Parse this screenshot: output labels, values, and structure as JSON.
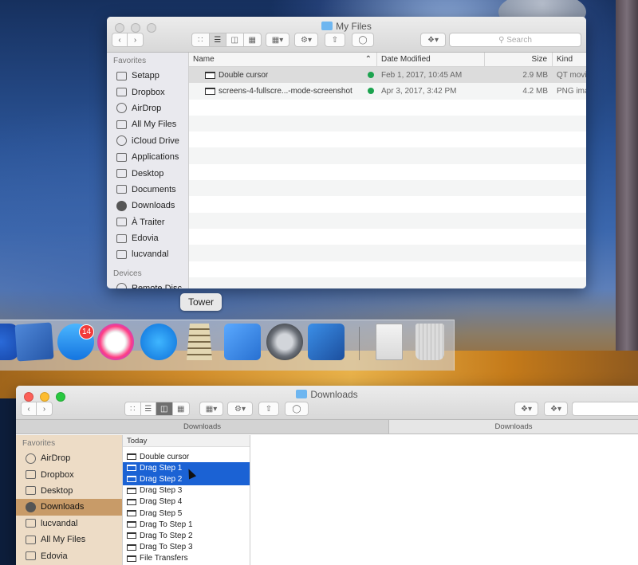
{
  "top_window": {
    "title": "My Files",
    "search_placeholder": "Search",
    "sidebar": {
      "favorites_heading": "Favorites",
      "items": [
        {
          "label": "Setapp",
          "icon": "folder-icon"
        },
        {
          "label": "Dropbox",
          "icon": "dropbox-folder-icon"
        },
        {
          "label": "AirDrop",
          "icon": "airdrop-icon"
        },
        {
          "label": "All My Files",
          "icon": "all-files-icon"
        },
        {
          "label": "iCloud Drive",
          "icon": "cloud-icon"
        },
        {
          "label": "Applications",
          "icon": "applications-icon"
        },
        {
          "label": "Desktop",
          "icon": "desktop-icon"
        },
        {
          "label": "Documents",
          "icon": "documents-icon"
        },
        {
          "label": "Downloads",
          "icon": "downloads-icon"
        },
        {
          "label": "À Traiter",
          "icon": "folder-icon"
        },
        {
          "label": "Edovia",
          "icon": "folder-icon"
        },
        {
          "label": "lucvandal",
          "icon": "home-icon"
        }
      ],
      "devices_heading": "Devices",
      "devices": [
        {
          "label": "Remote Disc",
          "icon": "disc-icon"
        }
      ]
    },
    "columns": {
      "name": "Name",
      "date": "Date Modified",
      "size": "Size",
      "kind": "Kind"
    },
    "files": [
      {
        "name": "Double cursor",
        "date": "Feb 1, 2017, 10:45 AM",
        "size": "2.9 MB",
        "kind": "QT movie"
      },
      {
        "name": "screens-4-fullscre...-mode-screenshot",
        "date": "Apr 3, 2017, 3:42 PM",
        "size": "4.2 MB",
        "kind": "PNG image"
      }
    ]
  },
  "dock": {
    "tooltip": "Tower",
    "messages_badge": "14",
    "apps": [
      "mail-icon",
      "messages-icon",
      "itunes-icon",
      "app-store-icon",
      "tower-icon",
      "xcode-icon",
      "system-preferences-icon",
      "vmware-fusion-icon",
      "disk-utility-icon",
      "trash-icon"
    ]
  },
  "bottom_window": {
    "title": "Downloads",
    "path_tabs": [
      "Downloads",
      "Downloads"
    ],
    "sidebar": {
      "favorites_heading": "Favorites",
      "items": [
        {
          "label": "AirDrop",
          "icon": "airdrop-icon"
        },
        {
          "label": "Dropbox",
          "icon": "dropbox-folder-icon"
        },
        {
          "label": "Desktop",
          "icon": "desktop-icon"
        },
        {
          "label": "Downloads",
          "icon": "downloads-icon",
          "selected": true
        },
        {
          "label": "lucvandal",
          "icon": "home-icon"
        },
        {
          "label": "All My Files",
          "icon": "all-files-icon"
        },
        {
          "label": "Edovia",
          "icon": "folder-icon"
        }
      ]
    },
    "column_heading": "Today",
    "items": [
      {
        "label": "Double cursor",
        "selected": false
      },
      {
        "label": "Drag Step 1",
        "selected": true
      },
      {
        "label": "Drag Step 2",
        "selected": true
      },
      {
        "label": "Drag Step 3",
        "selected": false
      },
      {
        "label": "Drag Step 4",
        "selected": false
      },
      {
        "label": "Drag Step 5",
        "selected": false
      },
      {
        "label": "Drag To Step 1",
        "selected": false
      },
      {
        "label": "Drag To Step 2",
        "selected": false
      },
      {
        "label": "Drag To Step 3",
        "selected": false
      },
      {
        "label": "File Transfers",
        "selected": false
      }
    ]
  },
  "colors": {
    "selection": "#1b62d4",
    "sidebar_selected": "#c89b68",
    "sync_ok": "#1ca34f",
    "badge": "#f23b3b"
  }
}
